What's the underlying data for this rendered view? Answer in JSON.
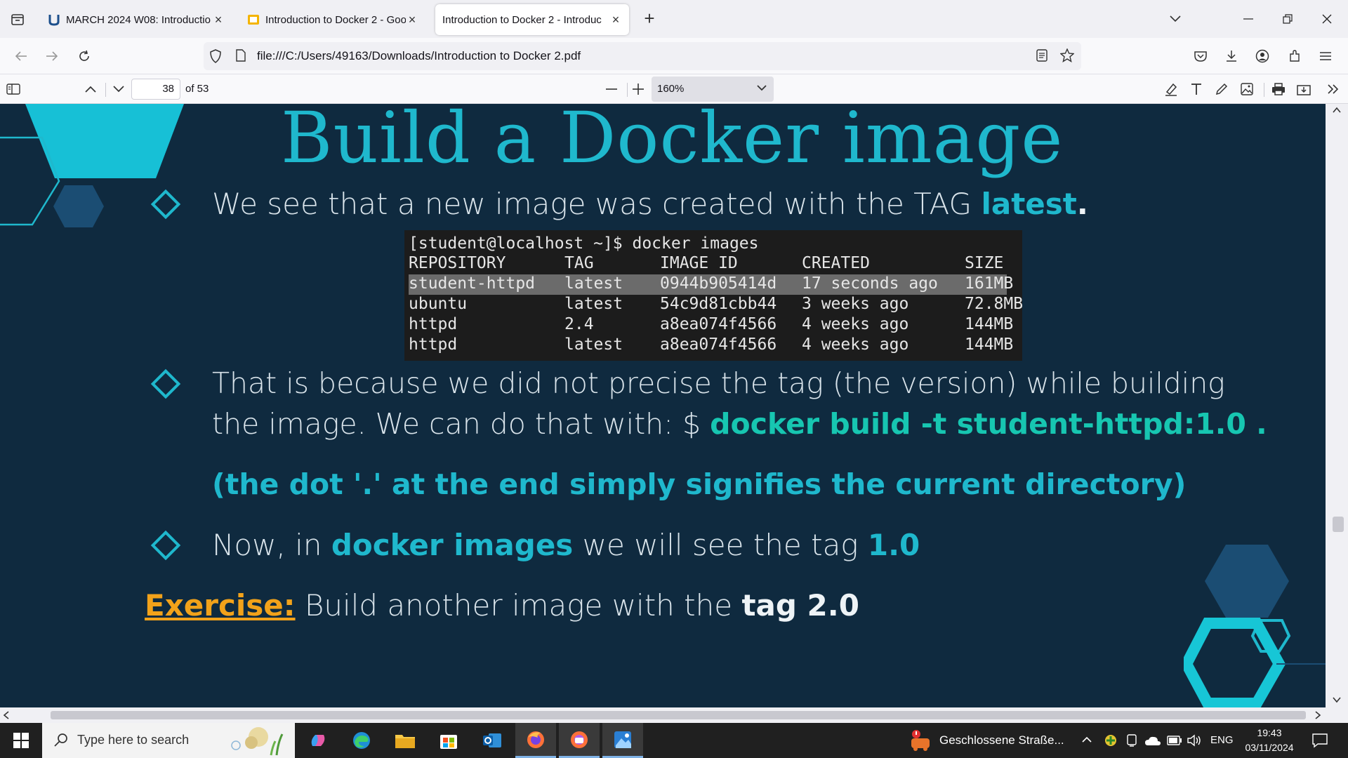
{
  "browser": {
    "tabs": [
      {
        "title": "MARCH 2024 W08: Introductio",
        "active": false
      },
      {
        "title": "Introduction to Docker 2 - Goo",
        "active": false
      },
      {
        "title": "Introduction to Docker 2 - Introduc",
        "active": true
      }
    ],
    "url": "file:///C:/Users/49163/Downloads/Introduction to Docker 2.pdf"
  },
  "pdf_toolbar": {
    "page_number": "38",
    "page_count": "of 53",
    "zoom": "160%"
  },
  "slide": {
    "title": "Build a Docker image",
    "bullet1": {
      "text": "We see that a new image was created with the TAG ",
      "highlight": "latest",
      "end": "."
    },
    "terminal": {
      "prompt": "[student@localhost ~]$ docker images",
      "headers": [
        "REPOSITORY",
        "TAG",
        "IMAGE ID",
        "CREATED",
        "SIZE"
      ],
      "rows": [
        [
          "student-httpd",
          "latest",
          "0944b905414d",
          "17 seconds ago",
          "161MB"
        ],
        [
          "ubuntu",
          "latest",
          "54c9d81cbb44",
          "3 weeks ago",
          "72.8MB"
        ],
        [
          "httpd",
          "2.4",
          "a8ea074f4566",
          "4 weeks ago",
          "144MB"
        ],
        [
          "httpd",
          "latest",
          "a8ea074f4566",
          "4 weeks ago",
          "144MB"
        ]
      ]
    },
    "bullet2": {
      "line1": "That is because we did not precise the tag (the version) while building",
      "line2_prefix": "the image. We can do that with: $ ",
      "command": "docker build -t student-httpd:1.0 ."
    },
    "note": "(the dot '.' at the end simply signifies the current directory)",
    "bullet3": {
      "prefix": "Now, in ",
      "highlight": "docker images",
      "middle": " we will see the tag ",
      "tag": "1.0"
    },
    "exercise": {
      "label": "Exercise:",
      "text": " Build another image with the ",
      "bold": "tag 2.0"
    }
  },
  "taskbar": {
    "search_placeholder": "Type here to search",
    "notification": "Geschlossene Straße...",
    "language": "ENG",
    "time": "19:43",
    "date": "03/11/2024"
  },
  "colors": {
    "slide_bg": "#0f2a3f",
    "accent": "#1fb8cd",
    "accent_green": "#17c6b1",
    "exercise": "#f2a21a"
  }
}
